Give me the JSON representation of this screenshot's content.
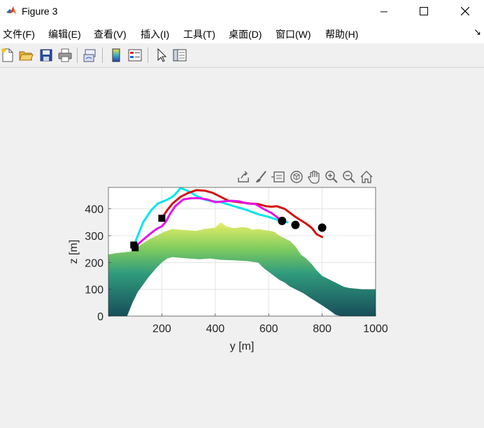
{
  "window": {
    "title": "Figure 3",
    "minimize_glyph": "─",
    "maximize_glyph": "☐",
    "close_glyph": "✕"
  },
  "menu": {
    "items": [
      "文件(F)",
      "编辑(E)",
      "查看(V)",
      "插入(I)",
      "工具(T)",
      "桌面(D)",
      "窗口(W)",
      "帮助(H)"
    ],
    "overflow_glyph": "↘"
  },
  "toolbar": {
    "buttons": [
      "new-figure-icon",
      "open-file-icon",
      "save-icon",
      "print-icon",
      "link-plot-icon",
      "colorbar-icon",
      "legend-icon",
      "pointer-icon",
      "property-editor-icon"
    ]
  },
  "axes_toolbar": {
    "tools": [
      "export-icon",
      "brush-icon",
      "data-tips-icon",
      "rotate-3d-icon",
      "pan-icon",
      "zoom-in-icon",
      "zoom-out-icon",
      "home-icon"
    ]
  },
  "chart_data": {
    "type": "line",
    "xlabel": "y [m]",
    "ylabel": "z [m]",
    "xlim": [
      0,
      1000
    ],
    "ylim": [
      0,
      480
    ],
    "xticks": [
      200,
      400,
      600,
      800,
      1000
    ],
    "yticks": [
      0,
      100,
      200,
      300,
      400
    ],
    "grid": true,
    "terrain": {
      "top": [
        [
          0,
          230
        ],
        [
          30,
          235
        ],
        [
          60,
          238
        ],
        [
          90,
          242
        ],
        [
          120,
          265
        ],
        [
          150,
          285
        ],
        [
          180,
          300
        ],
        [
          210,
          315
        ],
        [
          240,
          325
        ],
        [
          270,
          322
        ],
        [
          300,
          320
        ],
        [
          330,
          318
        ],
        [
          360,
          325
        ],
        [
          400,
          330
        ],
        [
          420,
          350
        ],
        [
          440,
          335
        ],
        [
          470,
          328
        ],
        [
          500,
          332
        ],
        [
          520,
          330
        ],
        [
          540,
          322
        ],
        [
          560,
          325
        ],
        [
          590,
          320
        ],
        [
          620,
          315
        ],
        [
          640,
          300
        ],
        [
          660,
          290
        ],
        [
          680,
          280
        ],
        [
          700,
          260
        ],
        [
          720,
          230
        ],
        [
          740,
          215
        ],
        [
          760,
          195
        ],
        [
          780,
          170
        ],
        [
          800,
          150
        ],
        [
          830,
          135
        ],
        [
          860,
          120
        ],
        [
          880,
          110
        ],
        [
          900,
          105
        ],
        [
          950,
          100
        ],
        [
          1000,
          100
        ]
      ],
      "bottom": [
        [
          0,
          0
        ],
        [
          70,
          0
        ],
        [
          90,
          50
        ],
        [
          110,
          90
        ],
        [
          150,
          145
        ],
        [
          180,
          180
        ],
        [
          200,
          200
        ],
        [
          220,
          215
        ],
        [
          240,
          220
        ],
        [
          260,
          218
        ],
        [
          300,
          215
        ],
        [
          340,
          212
        ],
        [
          380,
          215
        ],
        [
          420,
          210
        ],
        [
          470,
          208
        ],
        [
          520,
          205
        ],
        [
          560,
          200
        ],
        [
          580,
          180
        ],
        [
          600,
          165
        ],
        [
          620,
          150
        ],
        [
          640,
          135
        ],
        [
          660,
          125
        ],
        [
          680,
          110
        ],
        [
          700,
          100
        ],
        [
          730,
          85
        ],
        [
          760,
          65
        ],
        [
          800,
          40
        ],
        [
          830,
          20
        ],
        [
          850,
          5
        ],
        [
          870,
          0
        ],
        [
          1000,
          0
        ]
      ],
      "colors": [
        "#184e5a",
        "#2f9a7c",
        "#7fcc5f",
        "#e8ee66"
      ]
    },
    "series": [
      {
        "color": "#00e5ee",
        "x": [
          100,
          110,
          130,
          160,
          185,
          215,
          240,
          255,
          270,
          290,
          310,
          330,
          360,
          380,
          420,
          470,
          520,
          560,
          600,
          630,
          650,
          670
        ],
        "y": [
          275,
          300,
          350,
          395,
          420,
          432,
          445,
          460,
          478,
          470,
          460,
          448,
          435,
          430,
          425,
          410,
          395,
          380,
          370,
          360,
          355,
          350
        ]
      },
      {
        "color": "#d40f0f",
        "x": [
          200,
          220,
          240,
          270,
          300,
          330,
          360,
          390,
          420,
          450,
          490,
          530,
          560,
          590,
          610,
          630,
          660,
          700,
          740,
          760,
          780,
          800
        ],
        "y": [
          365,
          395,
          420,
          445,
          460,
          470,
          468,
          460,
          445,
          430,
          425,
          420,
          418,
          410,
          408,
          410,
          400,
          370,
          345,
          330,
          305,
          295
        ]
      },
      {
        "color": "#e514e5",
        "x": [
          95,
          110,
          130,
          160,
          180,
          200,
          215,
          230,
          250,
          280,
          310,
          340,
          370,
          400,
          430,
          460,
          490,
          520,
          550,
          580,
          610,
          630,
          650
        ],
        "y": [
          255,
          268,
          285,
          310,
          325,
          335,
          352,
          380,
          410,
          435,
          440,
          440,
          435,
          425,
          428,
          430,
          428,
          420,
          418,
          400,
          385,
          370,
          355
        ]
      }
    ],
    "start_markers": [
      [
        95,
        265
      ],
      [
        100,
        255
      ],
      [
        200,
        365
      ]
    ],
    "end_markers": [
      [
        650,
        355
      ],
      [
        700,
        340
      ],
      [
        800,
        330
      ]
    ]
  }
}
